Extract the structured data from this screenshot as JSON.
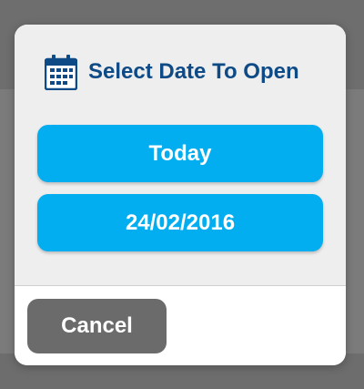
{
  "dialog": {
    "title": "Select Date To Open",
    "icon": "calendar-icon",
    "options": {
      "today_label": "Today",
      "date_label": "24/02/2016"
    },
    "cancel_label": "Cancel"
  },
  "colors": {
    "accent": "#03aef0",
    "title": "#0e4a86",
    "cancel_button": "#6b6b6b",
    "backdrop": "#666666"
  }
}
